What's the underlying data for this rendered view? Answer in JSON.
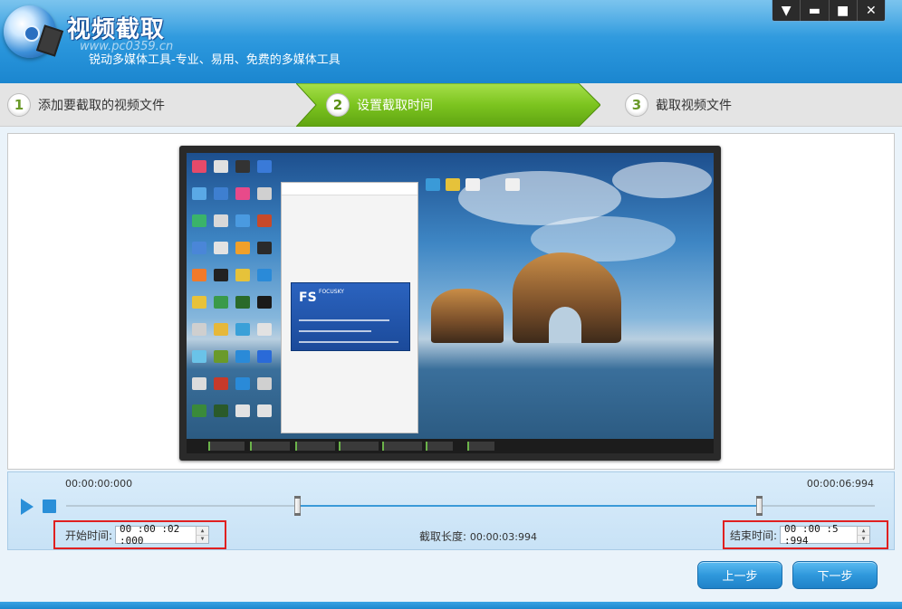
{
  "app": {
    "title": "视频截取",
    "watermark": "www.pc0359.cn",
    "subtitle": "锐动多媒体工具-专业、易用、免费的多媒体工具"
  },
  "window_controls": {
    "menu_icon": "▼",
    "minimize_icon": "▬",
    "maximize_icon": "■",
    "close_icon": "✕"
  },
  "steps": [
    {
      "number": "1",
      "label": "添加要截取的视频文件",
      "active": false
    },
    {
      "number": "2",
      "label": "设置截取时间",
      "active": true
    },
    {
      "number": "3",
      "label": "截取视频文件",
      "active": false
    }
  ],
  "preview": {
    "focusky_logo": "FS",
    "focusky_name": "FOCUSKY"
  },
  "timeline": {
    "start_time_label": "00:00:00:000",
    "end_time_label": "00:00:06:994",
    "selection_start_fraction": 0.286,
    "selection_end_fraction": 0.857
  },
  "clip": {
    "start_label": "开始时间:",
    "start_value": "00 :00 :02 :000",
    "length_label": "截取长度:",
    "length_value": "00:00:03:994",
    "end_label": "结束时间:",
    "end_value": "00 :00 :5 :994"
  },
  "buttons": {
    "prev": "上一步",
    "next": "下一步"
  },
  "colors": {
    "header_blue": "#2a96dc",
    "active_step_green": "#7cc41f",
    "highlight_red": "#e02020"
  }
}
